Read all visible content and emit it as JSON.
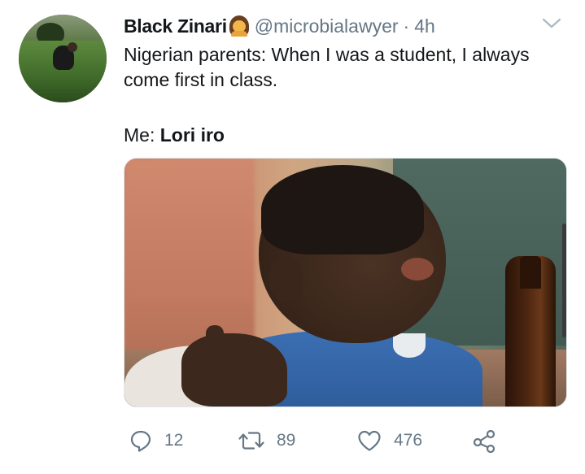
{
  "tweet": {
    "author_name": "Black Zinari",
    "handle": "@microbialawyer",
    "separator": "·",
    "time": "4h",
    "text_line1": "Nigerian parents: When I was a student, I always",
    "text_line2": "come first in class.",
    "me_prefix": "Me: ",
    "me_bold": "Lori iro"
  },
  "actions": {
    "reply_count": "12",
    "retweet_count": "89",
    "like_count": "476"
  },
  "icons": {
    "reply": "reply-icon",
    "retweet": "retweet-icon",
    "like": "heart-icon",
    "share": "share-icon",
    "menu": "chevron-down-icon"
  },
  "colors": {
    "text": "#14171a",
    "secondary": "#657786",
    "border": "#e1e8ed"
  }
}
